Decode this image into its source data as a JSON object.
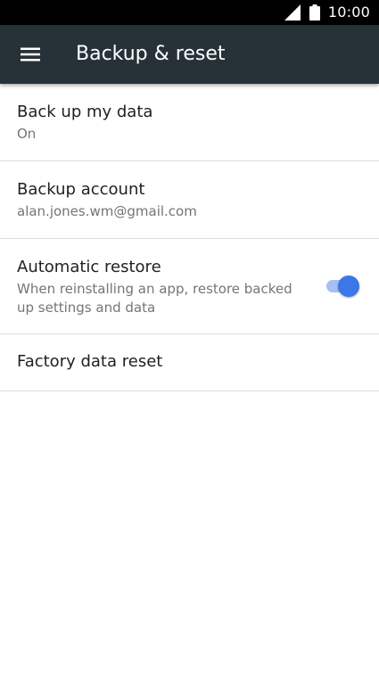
{
  "status_bar": {
    "time": "10:00",
    "signal_icon": "cell-signal-icon",
    "battery_icon": "battery-full-icon"
  },
  "app_bar": {
    "menu_icon": "hamburger-menu-icon",
    "title": "Backup & reset",
    "background_color": "#263238"
  },
  "settings": [
    {
      "title": "Back up my data",
      "subtitle": "On"
    },
    {
      "title": "Backup account",
      "subtitle": "alan.jones.wm@gmail.com"
    },
    {
      "title": "Automatic restore",
      "subtitle": "When reinstalling an app, restore backed up settings and data",
      "toggle_on": true
    },
    {
      "title": "Factory data reset"
    }
  ],
  "colors": {
    "toggle_thumb": "#3c76e8",
    "toggle_track": "#a7bff4"
  }
}
